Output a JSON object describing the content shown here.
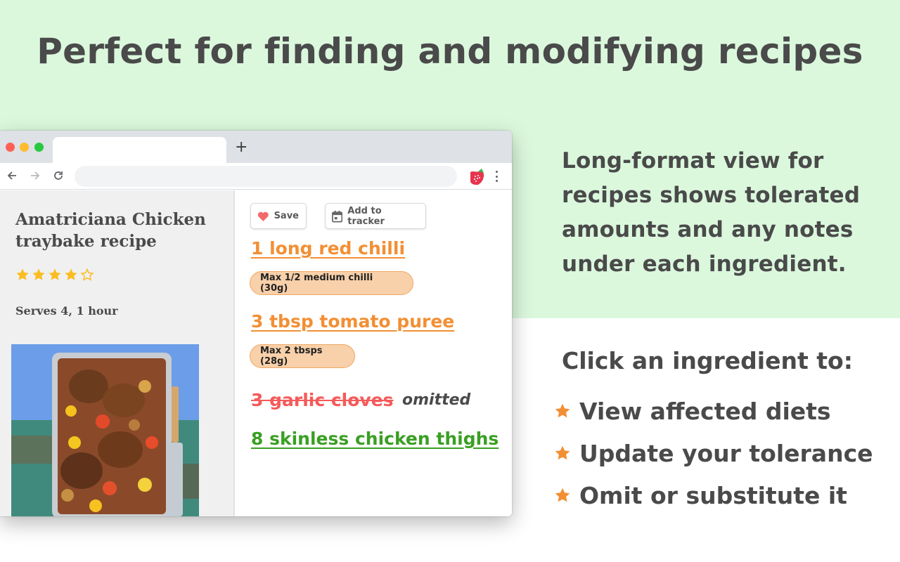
{
  "headline": "Perfect for finding and modifying recipes",
  "browser": {
    "new_tab_label": "+",
    "address": "",
    "icons": {
      "back": "arrow-left-icon",
      "forward": "arrow-right-icon",
      "reload": "reload-icon",
      "extension": "strawberry-icon",
      "menu": "more-vertical-icon"
    }
  },
  "recipe": {
    "title": "Amatriciana Chicken traybake recipe",
    "rating": 4,
    "rating_max": 5,
    "serves": "Serves 4, 1 hour",
    "photo_alt": "Chicken thighs with tomatoes and potatoes in a roasting tray"
  },
  "actions": {
    "save_label": "Save",
    "tracker_label": "Add to tracker"
  },
  "ingredients": [
    {
      "text": "1 long red chilli",
      "status": "limited",
      "note": "Max 1/2 medium chilli (30g)"
    },
    {
      "text": "3 tbsp tomato puree",
      "status": "limited",
      "note": "Max 2 tbsps (28g)"
    },
    {
      "text": "3 garlic cloves",
      "status": "omitted",
      "note": "omitted"
    },
    {
      "text": "8 skinless chicken thighs",
      "status": "safe",
      "note": ""
    }
  ],
  "description": "Long-format view for recipes shows tolerated amounts and any notes under each ingredient.",
  "click_title": "Click an ingredient to:",
  "bullets": [
    "View affected diets",
    "Update your tolerance",
    "Omit or substitute it"
  ],
  "colors": {
    "green_bg": "#dbf8dd",
    "orange": "#f28f34",
    "red": "#f55a5a",
    "green": "#3a9f23",
    "pill_bg": "#f8d0a9",
    "star_yellow": "#fbbd23",
    "text": "#4a4a4a"
  }
}
